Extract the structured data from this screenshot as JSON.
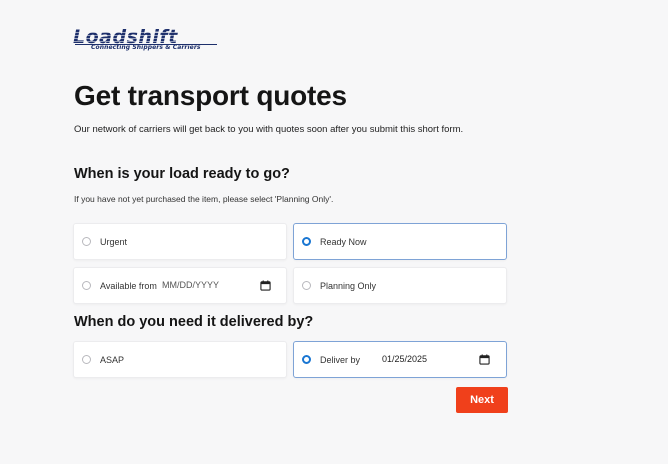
{
  "brand": {
    "name": "Loadshift",
    "tagline": "Connecting Shippers & Carriers"
  },
  "page": {
    "title": "Get transport quotes",
    "intro": "Our network of carriers will get back to you with quotes soon after you submit this short form."
  },
  "ready_section": {
    "heading": "When is your load ready to go?",
    "hint": "If you have not yet purchased the item, please select 'Planning Only'.",
    "options": [
      {
        "label": "Urgent",
        "selected": false
      },
      {
        "label": "Ready Now",
        "selected": true
      },
      {
        "label": "Available from",
        "selected": false,
        "date_placeholder": "MM/DD/YYYY"
      },
      {
        "label": "Planning Only",
        "selected": false
      }
    ]
  },
  "delivery_section": {
    "heading": "When do you need it delivered by?",
    "options": [
      {
        "label": "ASAP",
        "selected": false
      },
      {
        "label": "Deliver by",
        "selected": true,
        "date_value": "01/25/2025"
      }
    ]
  },
  "actions": {
    "next_label": "Next"
  },
  "colors": {
    "brand_navy": "#1d2f6b",
    "accent_blue": "#1976d2",
    "selected_border": "#7ea3d6",
    "next_button": "#f0401b"
  },
  "icons": {
    "date_picker": "calendar-icon",
    "radio": "radio-icon"
  }
}
